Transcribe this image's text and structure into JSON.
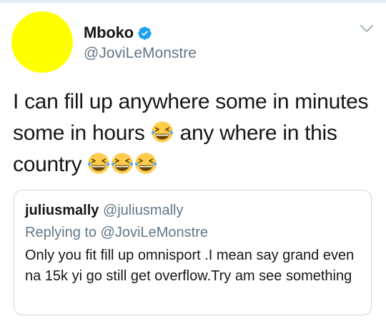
{
  "tweet": {
    "author": {
      "display_name": "Mboko",
      "handle": "@JoviLeMonstre",
      "avatar_color": "#ffff00",
      "verified": true,
      "verified_icon": "verified-badge-icon",
      "verified_color": "#1da1f2"
    },
    "menu_icon": "chevron-down-icon",
    "text_segments": [
      "I can fill up anywhere some in minutes some in hours ",
      " any where in this country "
    ],
    "emoji": "grinning-squinting-face-with-tears-icon"
  },
  "quoted_tweet": {
    "display_name": "juliusmally",
    "handle": "@juliusmally",
    "reply_prefix": "Replying to",
    "reply_to": "@JoviLeMonstre",
    "text": "Only you fit fill up omnisport .I mean say grand even na 15k yi go still get overflow.Try am see something"
  },
  "colors": {
    "primary_text": "#14171a",
    "secondary_text": "#657786",
    "link": "#1da1f2",
    "border": "#ccd6dd"
  }
}
